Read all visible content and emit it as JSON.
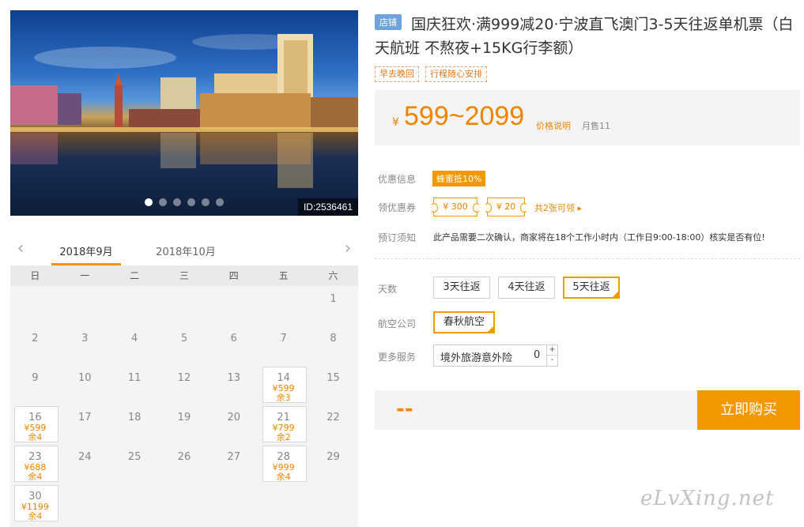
{
  "photo": {
    "id_label": "ID:2536461",
    "dots": 6,
    "active_dot": 0
  },
  "calendar": {
    "tabs": [
      "2018年9月",
      "2018年10月"
    ],
    "active_tab": 0,
    "weekdays": [
      "日",
      "一",
      "二",
      "三",
      "四",
      "五",
      "六"
    ],
    "lead_blanks": 6,
    "days": [
      {
        "d": "1"
      },
      {
        "d": "2"
      },
      {
        "d": "3"
      },
      {
        "d": "4"
      },
      {
        "d": "5"
      },
      {
        "d": "6"
      },
      {
        "d": "7"
      },
      {
        "d": "8"
      },
      {
        "d": "9"
      },
      {
        "d": "10"
      },
      {
        "d": "11"
      },
      {
        "d": "12"
      },
      {
        "d": "13"
      },
      {
        "d": "14",
        "price": "¥599",
        "stock": "余3"
      },
      {
        "d": "15"
      },
      {
        "d": "16",
        "price": "¥599",
        "stock": "余4"
      },
      {
        "d": "17"
      },
      {
        "d": "18"
      },
      {
        "d": "19"
      },
      {
        "d": "20"
      },
      {
        "d": "21",
        "price": "¥799",
        "stock": "余2"
      },
      {
        "d": "22"
      },
      {
        "d": "23",
        "price": "¥688",
        "stock": "余4"
      },
      {
        "d": "24"
      },
      {
        "d": "25"
      },
      {
        "d": "26"
      },
      {
        "d": "27"
      },
      {
        "d": "28",
        "price": "¥999",
        "stock": "余4"
      },
      {
        "d": "29"
      },
      {
        "d": "30",
        "price": "¥1199",
        "stock": "余4"
      }
    ]
  },
  "product": {
    "shop_badge": "店铺",
    "title": "国庆狂欢·满999减20·宁波直飞澳门3-5天往返单机票（白天航班 不熬夜+15KG行李额）",
    "tags": [
      "早去晚回",
      "行程随心安排"
    ],
    "price_yen": "¥",
    "price_range": "599~2099",
    "price_note": "价格说明",
    "monthly_sales": "月售11"
  },
  "info": {
    "discount_label": "优惠信息",
    "discount_badge": "蜂蜜抵10%",
    "coupon_label": "领优惠券",
    "coupons": [
      "¥ 300",
      "¥ 20"
    ],
    "coupon_link": "共2张可领 ▸",
    "booking_label": "预订须知",
    "booking_note": "此产品需要二次确认，商家将在18个工作小时内（工作日9:00-18:00）核实是否有位!"
  },
  "options": {
    "days_label": "天数",
    "days": [
      "3天往返",
      "4天往返",
      "5天往返"
    ],
    "days_selected": 2,
    "airline_label": "航空公司",
    "airline": "春秋航空",
    "service_label": "更多服务",
    "service_name": "境外旅游意外险",
    "service_qty": "0",
    "plus": "+",
    "minus": "-"
  },
  "buy": {
    "total": "--",
    "button": "立即购买"
  },
  "watermark": "eLvXing.net",
  "colors": {
    "accent": "#f39800",
    "price": "#f08300",
    "shop_badge": "#6fa3dc"
  }
}
